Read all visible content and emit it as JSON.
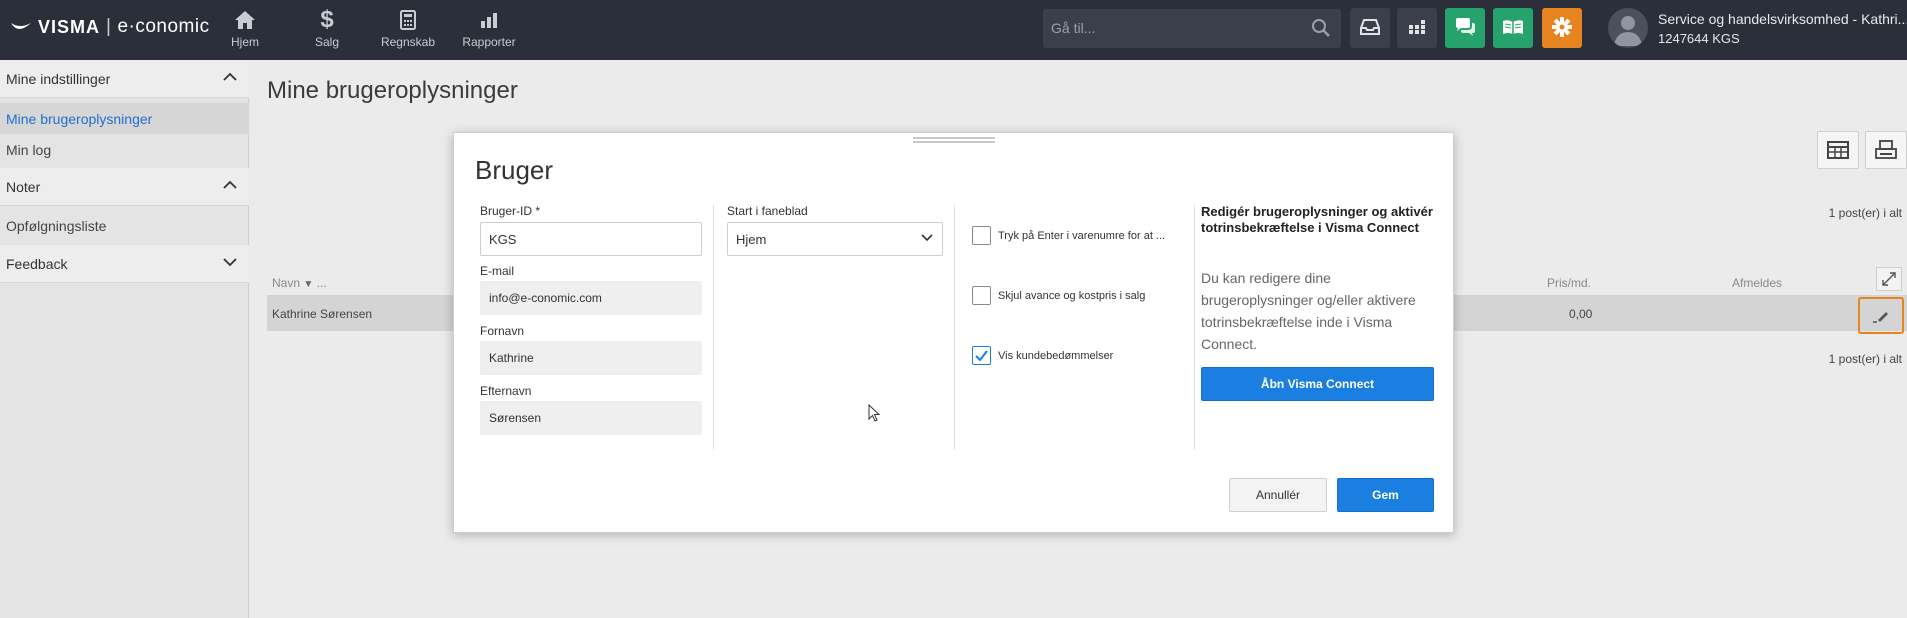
{
  "brand": {
    "name": "VISMA",
    "product": "e·conomic",
    "accent": "#1a7fe0",
    "orange": "#e8841f",
    "green": "#26a36c"
  },
  "nav": [
    {
      "label": "Hjem",
      "icon": "home-icon"
    },
    {
      "label": "Salg",
      "icon": "dollar-icon"
    },
    {
      "label": "Regnskab",
      "icon": "calculator-icon"
    },
    {
      "label": "Rapporter",
      "icon": "bar-chart-icon"
    }
  ],
  "search": {
    "placeholder": "Gå til..."
  },
  "toolbar_icons": [
    "inbox-icon",
    "apps-icon",
    "chat-icon",
    "book-icon",
    "gear-icon"
  ],
  "account": {
    "company": "Service og handelsvirksomhed - Kathri...",
    "id": "1247644 KGS"
  },
  "sidebar": {
    "sections": [
      {
        "label": "Mine indstillinger",
        "expanded": true
      },
      {
        "label": "Noter",
        "expanded": true
      },
      {
        "label": "Feedback",
        "expanded": false
      }
    ],
    "items": [
      {
        "label": "Mine brugeroplysninger",
        "active": true
      },
      {
        "label": "Min log"
      },
      {
        "label": "Opfølgningsliste"
      }
    ]
  },
  "page": {
    "title": "Mine brugeroplysninger",
    "count_top": "1 post(er) i alt",
    "count_bottom": "1 post(er) i alt",
    "columns": {
      "name": "Navn",
      "name_suffix": "...",
      "price": "Pris/md.",
      "cancel": "Afmeldes"
    },
    "rows": [
      {
        "name": "Kathrine Sørensen",
        "price": "0,00"
      }
    ]
  },
  "modal": {
    "title": "Bruger",
    "user_id": {
      "label": "Bruger-ID *",
      "value": "KGS"
    },
    "email": {
      "label": "E-mail",
      "value": "info@e-conomic.com"
    },
    "firstname": {
      "label": "Fornavn",
      "value": "Kathrine"
    },
    "lastname": {
      "label": "Efternavn",
      "value": "Sørensen"
    },
    "start_tab": {
      "label": "Start i faneblad",
      "value": "Hjem"
    },
    "checkboxes": [
      {
        "label": "Tryk på Enter i varenumre for at ...",
        "checked": false
      },
      {
        "label": "Skjul avance og kostpris i salg",
        "checked": false
      },
      {
        "label": "Vis kundebedømmelser",
        "checked": true
      }
    ],
    "info": {
      "title": "Redigér brugeroplysninger og aktivér totrinsbekræftelse i Visma Connect",
      "text": "Du kan redigere dine brugeroplysninger og/eller aktivere totrinsbekræftelse inde i Visma Connect.",
      "button": "Åbn Visma Connect"
    },
    "cancel_label": "Annullér",
    "save_label": "Gem"
  }
}
